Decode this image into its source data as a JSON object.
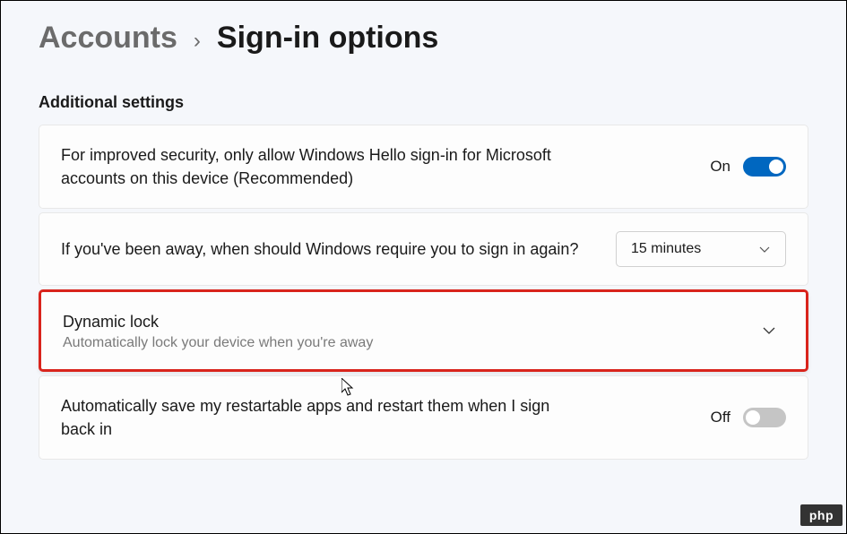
{
  "breadcrumb": {
    "parent": "Accounts",
    "current": "Sign-in options"
  },
  "section_title": "Additional settings",
  "items": [
    {
      "title": "For improved security, only allow Windows Hello sign-in for Microsoft accounts on this device (Recommended)",
      "toggle_label": "On",
      "toggle_state": "on"
    },
    {
      "title": "If you've been away, when should Windows require you to sign in again?",
      "dropdown_value": "15 minutes"
    },
    {
      "title": "Dynamic lock",
      "subtitle": "Automatically lock your device when you're away"
    },
    {
      "title": "Automatically save my restartable apps and restart them when I sign back in",
      "toggle_label": "Off",
      "toggle_state": "off"
    }
  ],
  "watermark": "php"
}
